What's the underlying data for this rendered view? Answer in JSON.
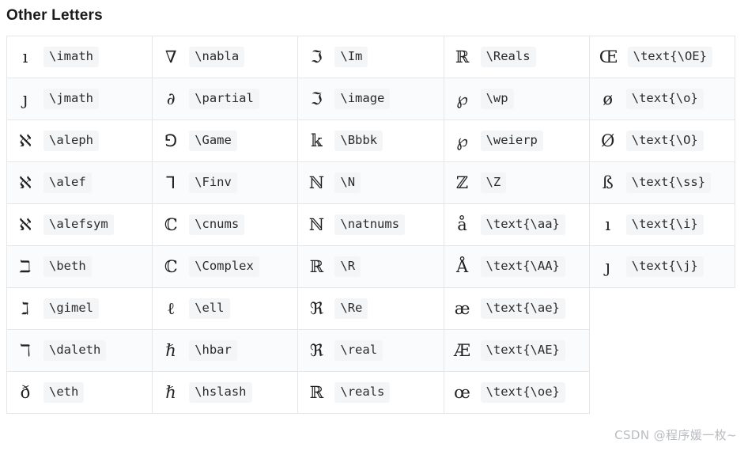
{
  "page": {
    "title": "Other Letters",
    "watermark": "CSDN @程序媛一枚~"
  },
  "table": {
    "rows": [
      [
        {
          "glyph": "ı",
          "cmd": "\\imath"
        },
        {
          "glyph": "∇",
          "cmd": "\\nabla"
        },
        {
          "glyph": "ℑ",
          "cmd": "\\Im"
        },
        {
          "glyph": "ℝ",
          "cmd": "\\Reals"
        },
        {
          "glyph": "Œ",
          "cmd": "\\text{\\OE}"
        }
      ],
      [
        {
          "glyph": "ȷ",
          "cmd": "\\jmath"
        },
        {
          "glyph": "∂",
          "cmd": "\\partial"
        },
        {
          "glyph": "ℑ",
          "cmd": "\\image"
        },
        {
          "glyph": "℘",
          "cmd": "\\wp"
        },
        {
          "glyph": "ø",
          "cmd": "\\text{\\o}"
        }
      ],
      [
        {
          "glyph": "ℵ",
          "cmd": "\\aleph"
        },
        {
          "glyph": "⅁",
          "cmd": "\\Game"
        },
        {
          "glyph": "𝕜",
          "cmd": "\\Bbbk"
        },
        {
          "glyph": "℘",
          "cmd": "\\weierp"
        },
        {
          "glyph": "Ø",
          "cmd": "\\text{\\O}"
        }
      ],
      [
        {
          "glyph": "ℵ",
          "cmd": "\\alef"
        },
        {
          "glyph": "⅂",
          "cmd": "\\Finv"
        },
        {
          "glyph": "ℕ",
          "cmd": "\\N"
        },
        {
          "glyph": "ℤ",
          "cmd": "\\Z"
        },
        {
          "glyph": "ß",
          "cmd": "\\text{\\ss}"
        }
      ],
      [
        {
          "glyph": "ℵ",
          "cmd": "\\alefsym"
        },
        {
          "glyph": "ℂ",
          "cmd": "\\cnums"
        },
        {
          "glyph": "ℕ",
          "cmd": "\\natnums"
        },
        {
          "glyph": "å",
          "cmd": "\\text{\\aa}"
        },
        {
          "glyph": "ı",
          "cmd": "\\text{\\i}"
        }
      ],
      [
        {
          "glyph": "ℶ",
          "cmd": "\\beth"
        },
        {
          "glyph": "ℂ",
          "cmd": "\\Complex"
        },
        {
          "glyph": "ℝ",
          "cmd": "\\R"
        },
        {
          "glyph": "Å",
          "cmd": "\\text{\\AA}"
        },
        {
          "glyph": "ȷ",
          "cmd": "\\text{\\j}"
        }
      ],
      [
        {
          "glyph": "ℷ",
          "cmd": "\\gimel"
        },
        {
          "glyph": "ℓ",
          "cmd": "\\ell"
        },
        {
          "glyph": "ℜ",
          "cmd": "\\Re"
        },
        {
          "glyph": "æ",
          "cmd": "\\text{\\ae}"
        },
        {
          "glyph": "",
          "cmd": ""
        }
      ],
      [
        {
          "glyph": "ℸ",
          "cmd": "\\daleth"
        },
        {
          "glyph": "ℏ",
          "cmd": "\\hbar"
        },
        {
          "glyph": "ℜ",
          "cmd": "\\real"
        },
        {
          "glyph": "Æ",
          "cmd": "\\text{\\AE}"
        },
        {
          "glyph": "",
          "cmd": ""
        }
      ],
      [
        {
          "glyph": "ð",
          "cmd": "\\eth"
        },
        {
          "glyph": "ℏ",
          "cmd": "\\hslash"
        },
        {
          "glyph": "ℝ",
          "cmd": "\\reals"
        },
        {
          "glyph": "œ",
          "cmd": "\\text{\\oe}"
        },
        {
          "glyph": "",
          "cmd": ""
        }
      ]
    ]
  }
}
